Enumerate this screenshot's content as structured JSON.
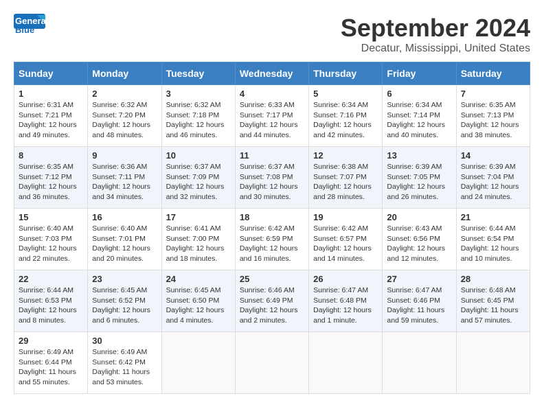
{
  "header": {
    "logo_general": "General",
    "logo_blue": "Blue",
    "title": "September 2024",
    "subtitle": "Decatur, Mississippi, United States"
  },
  "weekdays": [
    "Sunday",
    "Monday",
    "Tuesday",
    "Wednesday",
    "Thursday",
    "Friday",
    "Saturday"
  ],
  "weeks": [
    [
      {
        "day": "1",
        "sunrise": "6:31 AM",
        "sunset": "7:21 PM",
        "daylight": "12 hours and 49 minutes."
      },
      {
        "day": "2",
        "sunrise": "6:32 AM",
        "sunset": "7:20 PM",
        "daylight": "12 hours and 48 minutes."
      },
      {
        "day": "3",
        "sunrise": "6:32 AM",
        "sunset": "7:18 PM",
        "daylight": "12 hours and 46 minutes."
      },
      {
        "day": "4",
        "sunrise": "6:33 AM",
        "sunset": "7:17 PM",
        "daylight": "12 hours and 44 minutes."
      },
      {
        "day": "5",
        "sunrise": "6:34 AM",
        "sunset": "7:16 PM",
        "daylight": "12 hours and 42 minutes."
      },
      {
        "day": "6",
        "sunrise": "6:34 AM",
        "sunset": "7:14 PM",
        "daylight": "12 hours and 40 minutes."
      },
      {
        "day": "7",
        "sunrise": "6:35 AM",
        "sunset": "7:13 PM",
        "daylight": "12 hours and 38 minutes."
      }
    ],
    [
      {
        "day": "8",
        "sunrise": "6:35 AM",
        "sunset": "7:12 PM",
        "daylight": "12 hours and 36 minutes."
      },
      {
        "day": "9",
        "sunrise": "6:36 AM",
        "sunset": "7:11 PM",
        "daylight": "12 hours and 34 minutes."
      },
      {
        "day": "10",
        "sunrise": "6:37 AM",
        "sunset": "7:09 PM",
        "daylight": "12 hours and 32 minutes."
      },
      {
        "day": "11",
        "sunrise": "6:37 AM",
        "sunset": "7:08 PM",
        "daylight": "12 hours and 30 minutes."
      },
      {
        "day": "12",
        "sunrise": "6:38 AM",
        "sunset": "7:07 PM",
        "daylight": "12 hours and 28 minutes."
      },
      {
        "day": "13",
        "sunrise": "6:39 AM",
        "sunset": "7:05 PM",
        "daylight": "12 hours and 26 minutes."
      },
      {
        "day": "14",
        "sunrise": "6:39 AM",
        "sunset": "7:04 PM",
        "daylight": "12 hours and 24 minutes."
      }
    ],
    [
      {
        "day": "15",
        "sunrise": "6:40 AM",
        "sunset": "7:03 PM",
        "daylight": "12 hours and 22 minutes."
      },
      {
        "day": "16",
        "sunrise": "6:40 AM",
        "sunset": "7:01 PM",
        "daylight": "12 hours and 20 minutes."
      },
      {
        "day": "17",
        "sunrise": "6:41 AM",
        "sunset": "7:00 PM",
        "daylight": "12 hours and 18 minutes."
      },
      {
        "day": "18",
        "sunrise": "6:42 AM",
        "sunset": "6:59 PM",
        "daylight": "12 hours and 16 minutes."
      },
      {
        "day": "19",
        "sunrise": "6:42 AM",
        "sunset": "6:57 PM",
        "daylight": "12 hours and 14 minutes."
      },
      {
        "day": "20",
        "sunrise": "6:43 AM",
        "sunset": "6:56 PM",
        "daylight": "12 hours and 12 minutes."
      },
      {
        "day": "21",
        "sunrise": "6:44 AM",
        "sunset": "6:54 PM",
        "daylight": "12 hours and 10 minutes."
      }
    ],
    [
      {
        "day": "22",
        "sunrise": "6:44 AM",
        "sunset": "6:53 PM",
        "daylight": "12 hours and 8 minutes."
      },
      {
        "day": "23",
        "sunrise": "6:45 AM",
        "sunset": "6:52 PM",
        "daylight": "12 hours and 6 minutes."
      },
      {
        "day": "24",
        "sunrise": "6:45 AM",
        "sunset": "6:50 PM",
        "daylight": "12 hours and 4 minutes."
      },
      {
        "day": "25",
        "sunrise": "6:46 AM",
        "sunset": "6:49 PM",
        "daylight": "12 hours and 2 minutes."
      },
      {
        "day": "26",
        "sunrise": "6:47 AM",
        "sunset": "6:48 PM",
        "daylight": "12 hours and 1 minute."
      },
      {
        "day": "27",
        "sunrise": "6:47 AM",
        "sunset": "6:46 PM",
        "daylight": "11 hours and 59 minutes."
      },
      {
        "day": "28",
        "sunrise": "6:48 AM",
        "sunset": "6:45 PM",
        "daylight": "11 hours and 57 minutes."
      }
    ],
    [
      {
        "day": "29",
        "sunrise": "6:49 AM",
        "sunset": "6:44 PM",
        "daylight": "11 hours and 55 minutes."
      },
      {
        "day": "30",
        "sunrise": "6:49 AM",
        "sunset": "6:42 PM",
        "daylight": "11 hours and 53 minutes."
      },
      null,
      null,
      null,
      null,
      null
    ]
  ]
}
